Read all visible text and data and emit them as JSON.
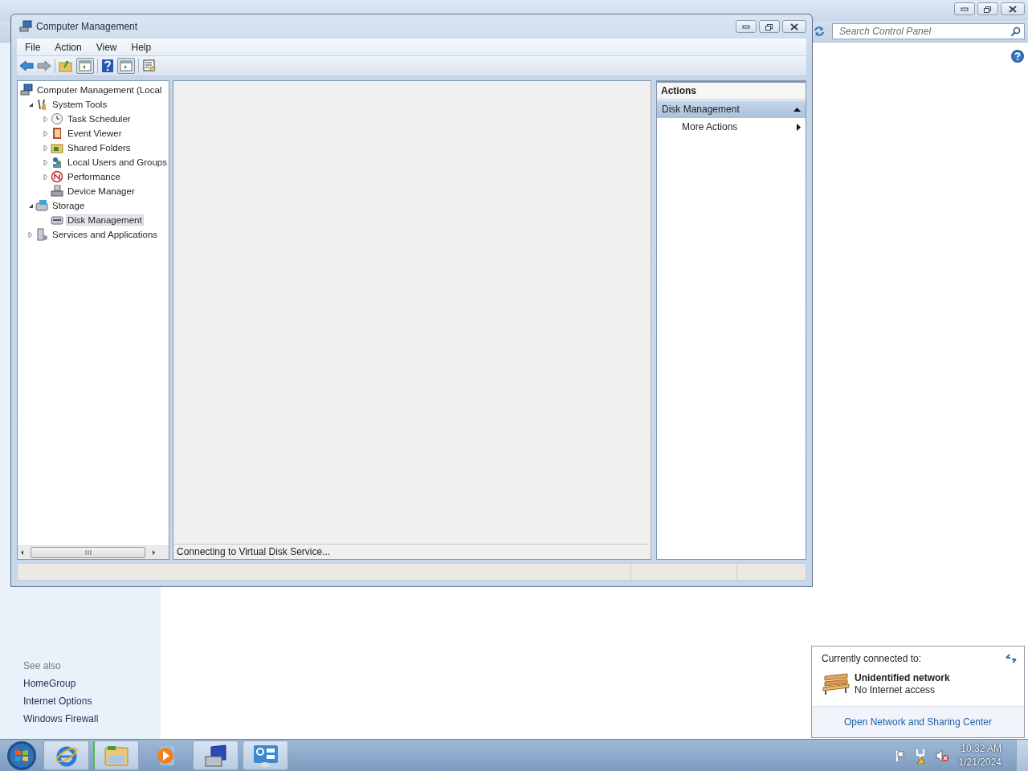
{
  "background_window": {
    "search": {
      "placeholder": "Search Control Panel"
    },
    "see_also": {
      "heading": "See also",
      "links": [
        "HomeGroup",
        "Internet Options",
        "Windows Firewall"
      ]
    }
  },
  "window": {
    "title": "Computer Management"
  },
  "menu": [
    "File",
    "Action",
    "View",
    "Help"
  ],
  "tree": [
    {
      "label": "Computer Management (Local",
      "selected": false,
      "children": [
        {
          "label": "System Tools",
          "expanded": true,
          "selected": false,
          "children": [
            {
              "label": "Task Scheduler",
              "expanded": false,
              "selected": false
            },
            {
              "label": "Event Viewer",
              "expanded": false,
              "selected": false
            },
            {
              "label": "Shared Folders",
              "expanded": false,
              "selected": false
            },
            {
              "label": "Local Users and Groups",
              "expanded": false,
              "selected": false
            },
            {
              "label": "Performance",
              "expanded": false,
              "selected": false
            },
            {
              "label": "Device Manager",
              "selected": false
            }
          ]
        },
        {
          "label": "Storage",
          "expanded": true,
          "selected": false,
          "children": [
            {
              "label": "Disk Management",
              "selected": true
            }
          ]
        },
        {
          "label": "Services and Applications",
          "expanded": false,
          "selected": false
        }
      ]
    }
  ],
  "center_status": "Connecting to Virtual Disk Service...",
  "actions": {
    "heading": "Actions",
    "section": {
      "label": "Disk Management",
      "expanded": true
    },
    "items": [
      {
        "label": "More Actions"
      }
    ]
  },
  "network_popup": {
    "heading": "Currently connected to:",
    "network_name": "Unidentified network",
    "network_status": "No Internet access",
    "link": "Open Network and Sharing Center"
  },
  "taskbar": {
    "time": "10:32 AM",
    "date": "1/21/2024"
  }
}
